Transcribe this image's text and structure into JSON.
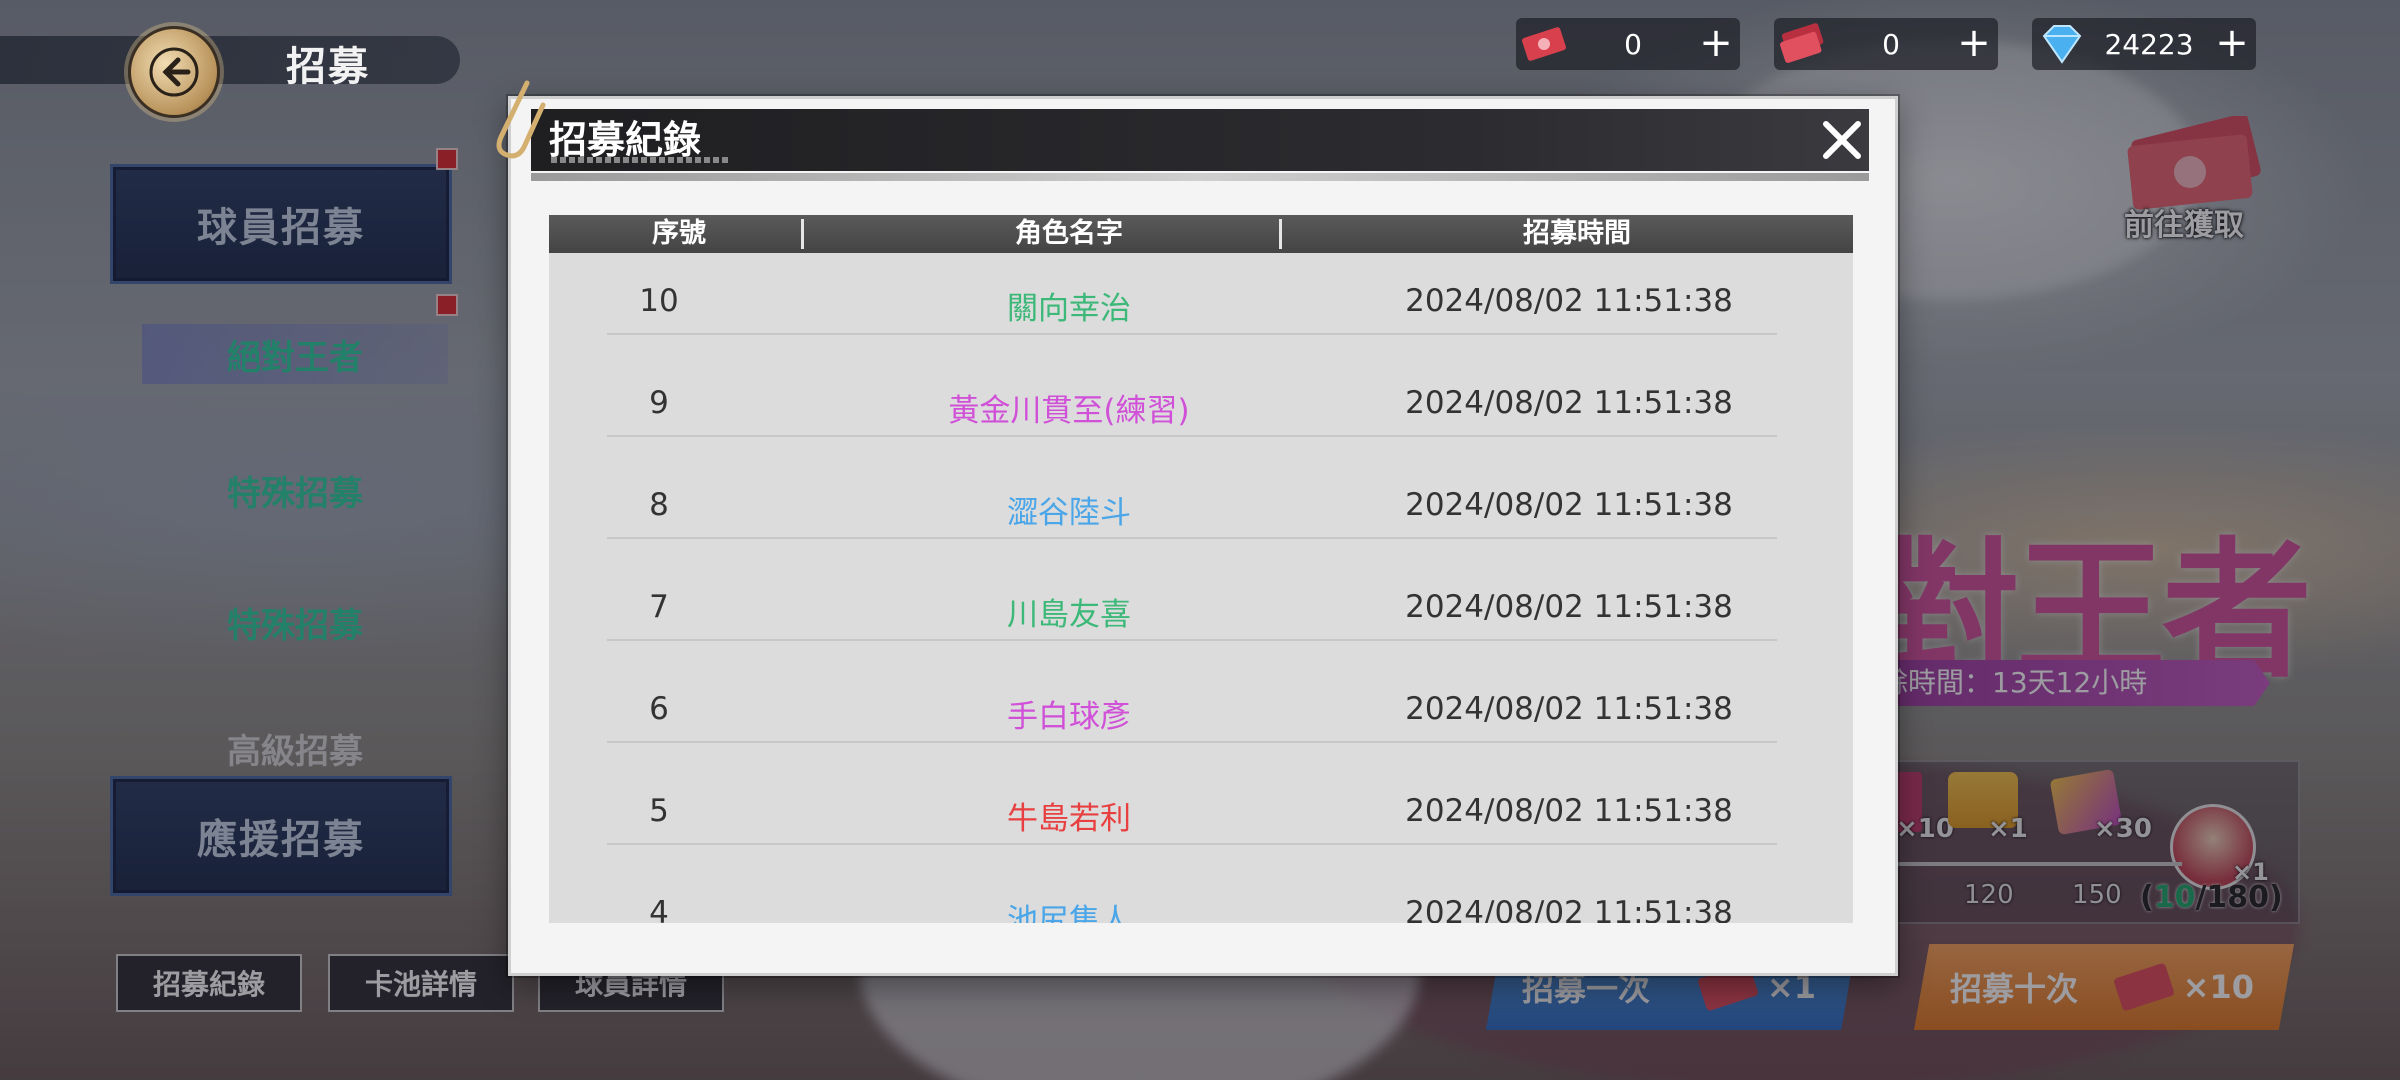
{
  "header": {
    "title": "招募"
  },
  "currencies": [
    {
      "icon": "red-ticket-icon",
      "value": "0"
    },
    {
      "icon": "red-ticket-stack-icon",
      "value": "0"
    },
    {
      "icon": "diamond-icon",
      "value": "24223"
    }
  ],
  "nav": {
    "player_recruit": "球員招募",
    "sub_items": [
      "絕對王者",
      "特殊招募",
      "特殊招募",
      "高級招募"
    ],
    "support_recruit": "應援招募"
  },
  "bottom_buttons": {
    "history": "招募紀錄",
    "pool_details": "卡池詳情",
    "player_details": "球員詳情"
  },
  "banner": {
    "title_fragment": "對王者",
    "time_remaining": "餘時間：13天12小時"
  },
  "rewards": {
    "items": [
      {
        "label": "×10"
      },
      {
        "label": "×1"
      },
      {
        "label": "×30"
      },
      {
        "label": "×1"
      }
    ],
    "milestones": [
      "120",
      "150"
    ],
    "progress_current": "10",
    "progress_total": "/180)",
    "progress_open": "("
  },
  "goto": {
    "label": "前往獲取"
  },
  "pull": {
    "one_label": "招募一次",
    "one_count": "×1",
    "ten_label": "招募十次",
    "ten_count": "×10"
  },
  "modal": {
    "title": "招募紀錄",
    "columns": [
      "序號",
      "角色名字",
      "招募時間"
    ],
    "rows": [
      {
        "no": "10",
        "name": "關向幸治",
        "color": "#3cb878",
        "time": "2024/08/02 11:51:38"
      },
      {
        "no": "9",
        "name": "黃金川貫至(練習)",
        "color": "#d050d8",
        "time": "2024/08/02 11:51:38"
      },
      {
        "no": "8",
        "name": "澀谷陸斗",
        "color": "#4aa6e8",
        "time": "2024/08/02 11:51:38"
      },
      {
        "no": "7",
        "name": "川島友喜",
        "color": "#3cb878",
        "time": "2024/08/02 11:51:38"
      },
      {
        "no": "6",
        "name": "手白球彥",
        "color": "#d050d8",
        "time": "2024/08/02 11:51:38"
      },
      {
        "no": "5",
        "name": "牛島若利",
        "color": "#e84040",
        "time": "2024/08/02 11:51:38"
      },
      {
        "no": "4",
        "name": "池尻隼人",
        "color": "#4aa6e8",
        "time": "2024/08/02 11:51:38"
      }
    ]
  }
}
